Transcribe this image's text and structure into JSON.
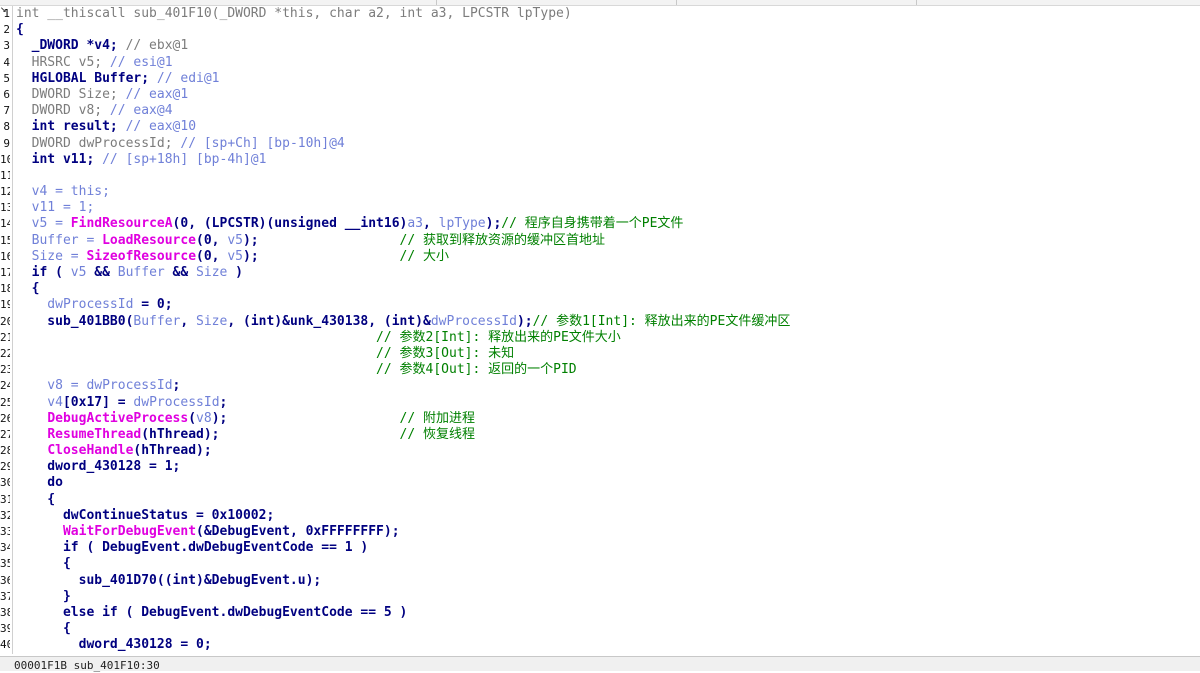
{
  "editor": {
    "corner_glyph": "↘",
    "status_text": "00001F1B sub_401F10:30"
  },
  "code_lines": [
    {
      "n": "1",
      "parts": [
        {
          "t": "int __thiscall sub_401F10(_DWORD *this, char a2, int a3, LPCSTR lpType)",
          "c": "gray"
        }
      ]
    },
    {
      "n": "2",
      "parts": [
        {
          "t": "{",
          "c": "plain"
        }
      ]
    },
    {
      "n": "3",
      "parts": [
        {
          "t": "  _DWORD *v4; ",
          "c": "plain"
        },
        {
          "t": "// ebx@1",
          "c": "gray"
        }
      ]
    },
    {
      "n": "4",
      "parts": [
        {
          "t": "  HRSRC v5; ",
          "c": "gray"
        },
        {
          "t": "// esi@1",
          "c": "data"
        }
      ]
    },
    {
      "n": "5",
      "parts": [
        {
          "t": "  HGLOBAL Buffer; ",
          "c": "plain"
        },
        {
          "t": "// edi@1",
          "c": "data"
        }
      ]
    },
    {
      "n": "6",
      "parts": [
        {
          "t": "  DWORD Size; ",
          "c": "gray"
        },
        {
          "t": "// eax@1",
          "c": "data"
        }
      ]
    },
    {
      "n": "7",
      "parts": [
        {
          "t": "  DWORD v8; ",
          "c": "gray"
        },
        {
          "t": "// eax@4",
          "c": "data"
        }
      ]
    },
    {
      "n": "8",
      "parts": [
        {
          "t": "  int result; ",
          "c": "plain"
        },
        {
          "t": "// eax@10",
          "c": "data"
        }
      ]
    },
    {
      "n": "9",
      "parts": [
        {
          "t": "  DWORD dwProcessId; ",
          "c": "gray"
        },
        {
          "t": "// [sp+Ch] [bp-10h]@4",
          "c": "data"
        }
      ]
    },
    {
      "n": "10",
      "parts": [
        {
          "t": "  int v11; ",
          "c": "plain"
        },
        {
          "t": "// [sp+18h] [bp-4h]@1",
          "c": "data"
        }
      ]
    },
    {
      "n": "11",
      "parts": []
    },
    {
      "n": "12",
      "parts": [
        {
          "t": "  v4 = this;",
          "c": "data"
        }
      ]
    },
    {
      "n": "13",
      "parts": [
        {
          "t": "  v11 = 1;",
          "c": "data"
        }
      ]
    },
    {
      "n": "14",
      "parts": [
        {
          "t": "  v5 = ",
          "c": "data"
        },
        {
          "t": "FindResourceA",
          "c": "api"
        },
        {
          "t": "(0, (LPCSTR)(unsigned __int16)",
          "c": "plain"
        },
        {
          "t": "a3",
          "c": "data"
        },
        {
          "t": ", ",
          "c": "plain"
        },
        {
          "t": "lpType",
          "c": "data"
        },
        {
          "t": ");",
          "c": "plain"
        },
        {
          "t": "// 程序自身携带着一个PE文件",
          "c": "cm"
        }
      ]
    },
    {
      "n": "15",
      "parts": [
        {
          "t": "  Buffer = ",
          "c": "data"
        },
        {
          "t": "LoadResource",
          "c": "api"
        },
        {
          "t": "(0, ",
          "c": "plain"
        },
        {
          "t": "v5",
          "c": "data"
        },
        {
          "t": ");                  ",
          "c": "plain"
        },
        {
          "t": "// 获取到释放资源的缓冲区首地址",
          "c": "cm"
        }
      ]
    },
    {
      "n": "16",
      "parts": [
        {
          "t": "  Size = ",
          "c": "data"
        },
        {
          "t": "SizeofResource",
          "c": "api"
        },
        {
          "t": "(0, ",
          "c": "plain"
        },
        {
          "t": "v5",
          "c": "data"
        },
        {
          "t": ");                  ",
          "c": "plain"
        },
        {
          "t": "// 大小",
          "c": "cm"
        }
      ]
    },
    {
      "n": "17",
      "parts": [
        {
          "t": "  if ( ",
          "c": "plain"
        },
        {
          "t": "v5",
          "c": "data"
        },
        {
          "t": " && ",
          "c": "plain"
        },
        {
          "t": "Buffer",
          "c": "data"
        },
        {
          "t": " && ",
          "c": "plain"
        },
        {
          "t": "Size",
          "c": "data"
        },
        {
          "t": " )",
          "c": "plain"
        }
      ]
    },
    {
      "n": "18",
      "parts": [
        {
          "t": "  {",
          "c": "plain"
        }
      ]
    },
    {
      "n": "19",
      "parts": [
        {
          "t": "    dwProcessId",
          "c": "data"
        },
        {
          "t": " = 0;",
          "c": "plain"
        }
      ]
    },
    {
      "n": "20",
      "parts": [
        {
          "t": "    sub_401BB0(",
          "c": "plain"
        },
        {
          "t": "Buffer",
          "c": "data"
        },
        {
          "t": ", ",
          "c": "plain"
        },
        {
          "t": "Size",
          "c": "data"
        },
        {
          "t": ", (int)&unk_430138, (int)&",
          "c": "plain"
        },
        {
          "t": "dwProcessId",
          "c": "data"
        },
        {
          "t": ");",
          "c": "plain"
        },
        {
          "t": "// 参数1[Int]: 释放出来的PE文件缓冲区",
          "c": "cm"
        }
      ]
    },
    {
      "n": "21",
      "parts": [
        {
          "t": "                                              ",
          "c": "plain"
        },
        {
          "t": "// 参数2[Int]: 释放出来的PE文件大小",
          "c": "cm"
        }
      ]
    },
    {
      "n": "22",
      "parts": [
        {
          "t": "                                              ",
          "c": "plain"
        },
        {
          "t": "// 参数3[Out]: 未知",
          "c": "cm"
        }
      ]
    },
    {
      "n": "23",
      "parts": [
        {
          "t": "                                              ",
          "c": "plain"
        },
        {
          "t": "// 参数4[Out]: 返回的一个PID",
          "c": "cm"
        }
      ]
    },
    {
      "n": "24",
      "parts": [
        {
          "t": "    v8 = ",
          "c": "data"
        },
        {
          "t": "dwProcessId",
          "c": "data"
        },
        {
          "t": ";",
          "c": "plain"
        }
      ]
    },
    {
      "n": "25",
      "parts": [
        {
          "t": "    v4",
          "c": "data"
        },
        {
          "t": "[0x17] = ",
          "c": "plain"
        },
        {
          "t": "dwProcessId",
          "c": "data"
        },
        {
          "t": ";",
          "c": "plain"
        }
      ]
    },
    {
      "n": "26",
      "parts": [
        {
          "t": "    ",
          "c": "plain"
        },
        {
          "t": "DebugActiveProcess",
          "c": "api"
        },
        {
          "t": "(",
          "c": "plain"
        },
        {
          "t": "v8",
          "c": "data"
        },
        {
          "t": ");                      ",
          "c": "plain"
        },
        {
          "t": "// 附加进程",
          "c": "cm"
        }
      ]
    },
    {
      "n": "27",
      "parts": [
        {
          "t": "    ",
          "c": "plain"
        },
        {
          "t": "ResumeThread",
          "c": "api"
        },
        {
          "t": "(hThread);                       ",
          "c": "plain"
        },
        {
          "t": "// 恢复线程",
          "c": "cm"
        }
      ]
    },
    {
      "n": "28",
      "parts": [
        {
          "t": "    ",
          "c": "plain"
        },
        {
          "t": "CloseHandle",
          "c": "api"
        },
        {
          "t": "(hThread);",
          "c": "plain"
        }
      ]
    },
    {
      "n": "29",
      "parts": [
        {
          "t": "    dword_430128 = 1;",
          "c": "plain"
        }
      ]
    },
    {
      "n": "30",
      "parts": [
        {
          "t": "    do",
          "c": "plain"
        }
      ]
    },
    {
      "n": "31",
      "parts": [
        {
          "t": "    {",
          "c": "plain"
        }
      ]
    },
    {
      "n": "32",
      "parts": [
        {
          "t": "      dwContinueStatus = 0x10002;",
          "c": "plain"
        }
      ]
    },
    {
      "n": "33",
      "parts": [
        {
          "t": "      ",
          "c": "plain"
        },
        {
          "t": "WaitForDebugEvent",
          "c": "api"
        },
        {
          "t": "(&DebugEvent, 0xFFFFFFFF);",
          "c": "plain"
        }
      ]
    },
    {
      "n": "34",
      "parts": [
        {
          "t": "      if ( DebugEvent.dwDebugEventCode == 1 )",
          "c": "plain"
        }
      ]
    },
    {
      "n": "35",
      "parts": [
        {
          "t": "      {",
          "c": "plain"
        }
      ]
    },
    {
      "n": "36",
      "parts": [
        {
          "t": "        sub_401D70((int)&DebugEvent.u);",
          "c": "plain"
        }
      ]
    },
    {
      "n": "37",
      "parts": [
        {
          "t": "      }",
          "c": "plain"
        }
      ]
    },
    {
      "n": "38",
      "parts": [
        {
          "t": "      else if ( DebugEvent.dwDebugEventCode == 5 )",
          "c": "plain"
        }
      ]
    },
    {
      "n": "39",
      "parts": [
        {
          "t": "      {",
          "c": "plain"
        }
      ]
    },
    {
      "n": "40",
      "parts": [
        {
          "t": "        dword_430128 = 0;",
          "c": "plain"
        }
      ]
    }
  ]
}
